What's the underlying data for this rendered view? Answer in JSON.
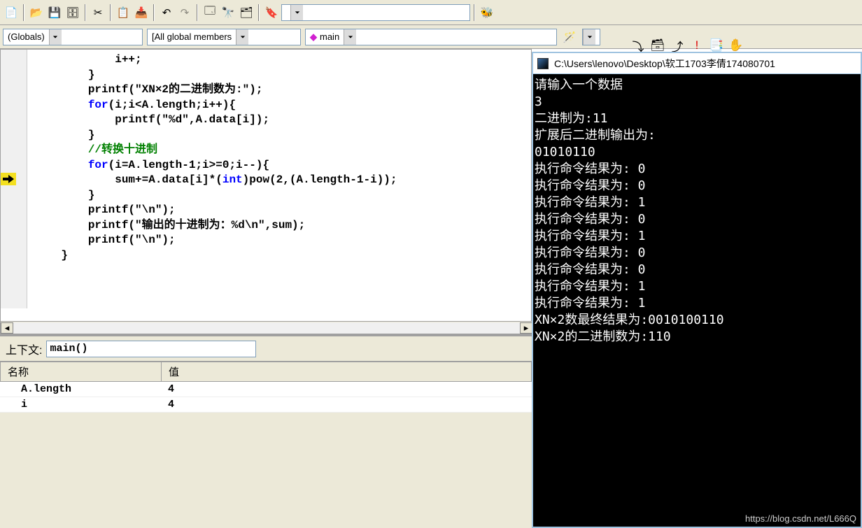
{
  "toolbar1": {
    "icons": [
      "new-file",
      "open",
      "save",
      "save-all",
      "cut",
      "copy",
      "paste",
      "undo",
      "redo",
      "window-list",
      "find",
      "find-in-files",
      "bookmark",
      "help-find"
    ]
  },
  "toolbar2": {
    "scope_combo": "(Globals)",
    "members_combo": "[All global members",
    "function_combo": "main",
    "empty_combo": ""
  },
  "right_tools": {
    "icons": [
      "step-into",
      "step-over",
      "step-out",
      "breakpoint",
      "watch",
      "hand"
    ]
  },
  "code": {
    "lines": [
      {
        "indent": 12,
        "text": "i++;"
      },
      {
        "indent": 8,
        "text": "}"
      },
      {
        "indent": 8,
        "text_parts": [
          {
            "t": "printf",
            "c": ""
          },
          {
            "t": "(\"XN×2的二进制数为:\");",
            "c": ""
          }
        ]
      },
      {
        "indent": 8,
        "text_parts": [
          {
            "t": "for",
            "c": "kw"
          },
          {
            "t": "(i;i<A.length;i++){",
            "c": ""
          }
        ]
      },
      {
        "indent": 12,
        "text_parts": [
          {
            "t": "printf",
            "c": ""
          },
          {
            "t": "(\"%d\",A.data[i]);",
            "c": ""
          }
        ]
      },
      {
        "indent": 8,
        "text": "}"
      },
      {
        "indent": 8,
        "text_parts": [
          {
            "t": "//转换十进制",
            "c": "cm"
          }
        ]
      },
      {
        "indent": 8,
        "text_parts": [
          {
            "t": "for",
            "c": "kw"
          },
          {
            "t": "(i=A.length-1;i>=0;i--){",
            "c": ""
          }
        ]
      },
      {
        "indent": 12,
        "text_parts": [
          {
            "t": "sum+=A.data[i]*(",
            "c": ""
          },
          {
            "t": "int",
            "c": "kw"
          },
          {
            "t": ")pow(2,(A.length-1-i));",
            "c": ""
          }
        ]
      },
      {
        "indent": 8,
        "text": "}"
      },
      {
        "indent": 8,
        "text": "printf(\"\\n\");"
      },
      {
        "indent": 8,
        "text": "printf(\"输出的十进制为：%d\\n\",sum);"
      },
      {
        "indent": 8,
        "text": "printf(\"\\n\");"
      },
      {
        "indent": 0,
        "text": ""
      },
      {
        "indent": 4,
        "text": "}"
      }
    ]
  },
  "debug": {
    "context_label": "上下文:",
    "context_value": "main()",
    "columns": {
      "name": "名称",
      "value": "值"
    },
    "vars": [
      {
        "name": "A.length",
        "value": "4"
      },
      {
        "name": "i",
        "value": "4"
      }
    ]
  },
  "console": {
    "title": "C:\\Users\\lenovo\\Desktop\\软工1703李倩174080701",
    "lines": [
      "请输入一个数据",
      "3",
      "二进制为:11",
      "扩展后二进制输出为:",
      "01010110",
      "执行命令结果为: 0",
      "执行命令结果为: 0",
      "执行命令结果为: 1",
      "执行命令结果为: 0",
      "执行命令结果为: 1",
      "执行命令结果为: 0",
      "执行命令结果为: 0",
      "执行命令结果为: 1",
      "执行命令结果为: 1",
      "XN×2数最终结果为:0010100110",
      "XN×2的二进制数为:110"
    ]
  },
  "watermark": "https://blog.csdn.net/L666Q"
}
